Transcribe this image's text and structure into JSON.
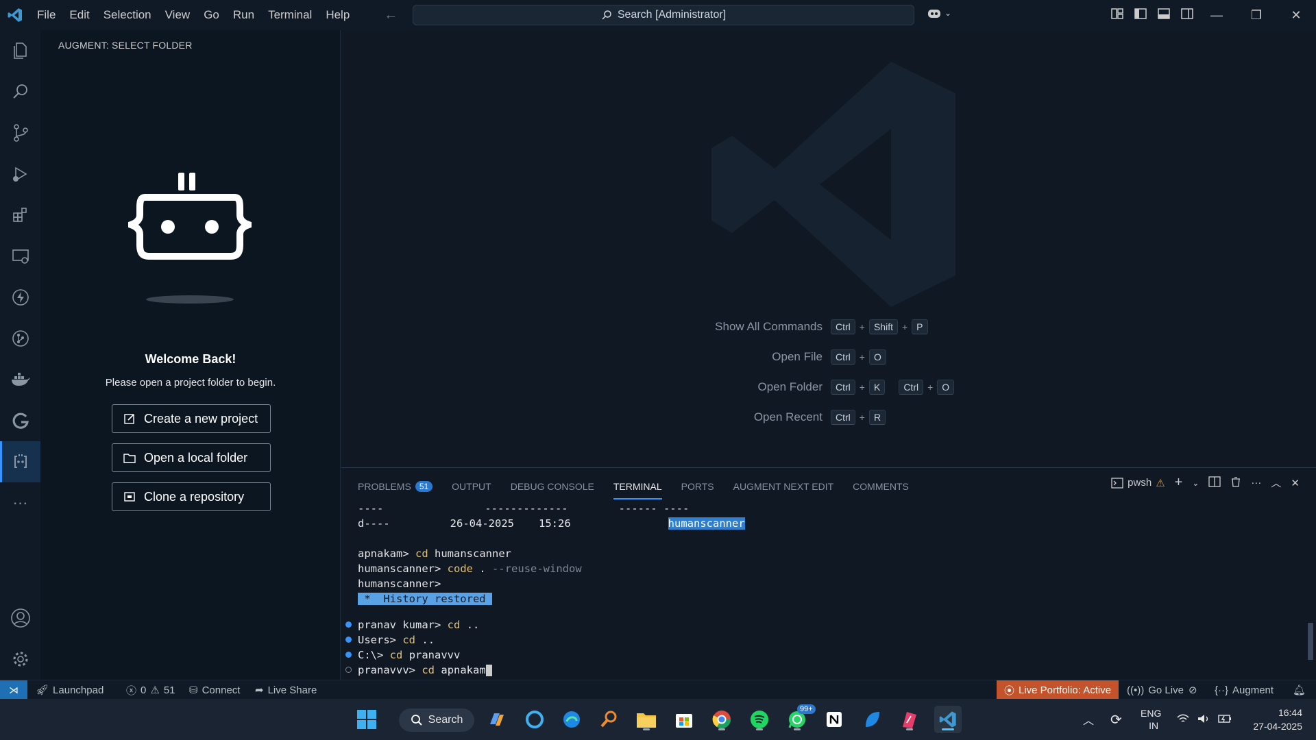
{
  "titlebar": {
    "menu": [
      "File",
      "Edit",
      "Selection",
      "View",
      "Go",
      "Run",
      "Terminal",
      "Help"
    ],
    "search_text": "Search [Administrator]"
  },
  "activitybar": {
    "icons": [
      "explorer-icon",
      "search-icon",
      "source-control-icon",
      "run-debug-icon",
      "extensions-icon",
      "remote-explorer-icon",
      "lightning-icon",
      "git-graph-icon",
      "docker-icon",
      "gitlens-icon",
      "augment-icon",
      "more-icon",
      "account-icon",
      "settings-gear-icon"
    ]
  },
  "sidebar": {
    "title": "AUGMENT: SELECT FOLDER",
    "welcome_title": "Welcome Back!",
    "welcome_sub": "Please open a project folder to begin.",
    "buttons": [
      "Create a new project",
      "Open a local folder",
      "Clone a repository"
    ]
  },
  "editor": {
    "shortcuts": [
      {
        "label": "Show All Commands",
        "keys": [
          "Ctrl",
          "+",
          "Shift",
          "+",
          "P"
        ]
      },
      {
        "label": "Open File",
        "keys": [
          "Ctrl",
          "+",
          "O"
        ]
      },
      {
        "label": "Open Folder",
        "keys": [
          "Ctrl",
          "+",
          "K",
          "Ctrl",
          "+",
          "O"
        ]
      },
      {
        "label": "Open Recent",
        "keys": [
          "Ctrl",
          "+",
          "R"
        ]
      }
    ]
  },
  "panel": {
    "tabs": [
      "PROBLEMS",
      "OUTPUT",
      "DEBUG CONSOLE",
      "TERMINAL",
      "PORTS",
      "AUGMENT NEXT EDIT",
      "COMMENTS"
    ],
    "problems_count": "51",
    "active_tab": "TERMINAL",
    "shell": "pwsh",
    "terminal": {
      "l1a": "----",
      "l1b": "-------------",
      "l1c": "------ ----",
      "l2a": "d----",
      "l2b": "26-04-2025",
      "l2c": "15:26",
      "l2d": "humanscanner",
      "l3p": "apnakam>",
      "l3c": "cd",
      "l3a": "humanscanner",
      "l4p": "humanscanner>",
      "l4c": "code",
      "l4a": ".",
      "l4f": "--reuse-window",
      "l5p": "humanscanner>",
      "l6": " *  History restored ",
      "l7p": "pranav kumar>",
      "l7c": "cd",
      "l7a": "..",
      "l8p": "Users>",
      "l8c": "cd",
      "l8a": "..",
      "l9p": "C:\\>",
      "l9c": "cd",
      "l9a": "pranavvv",
      "l10p": "pranavvv>",
      "l10c": "cd",
      "l10a": "apnakam"
    }
  },
  "statusbar": {
    "launchpad": "Launchpad",
    "errors": "0",
    "warnings": "51",
    "connect": "Connect",
    "liveshare": "Live Share",
    "live_portfolio": "Live Portfolio: Active",
    "golive": "Go Live",
    "augment": "Augment"
  },
  "taskbar": {
    "search": "Search",
    "badge": "99+",
    "lang1": "ENG",
    "lang2": "IN",
    "time": "16:44",
    "date": "27-04-2025"
  }
}
